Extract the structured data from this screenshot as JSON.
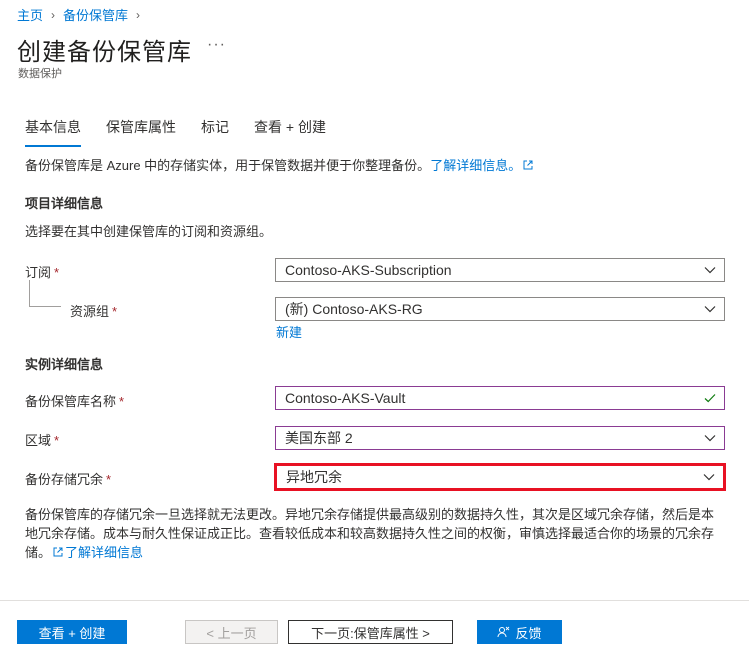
{
  "breadcrumb": {
    "home": "主页",
    "vault": "备份保管库"
  },
  "header": {
    "title": "创建备份保管库",
    "more": "···",
    "subtitle": "数据保护"
  },
  "tabs": [
    {
      "label": "基本信息",
      "active": true
    },
    {
      "label": "保管库属性",
      "active": false
    },
    {
      "label": "标记",
      "active": false
    },
    {
      "label": "查看 + 创建",
      "active": false
    }
  ],
  "intro": {
    "text": "备份保管库是 Azure 中的存储实体，用于保管数据并便于你整理备份。",
    "link": "了解详细信息。"
  },
  "project": {
    "heading": "项目详细信息",
    "desc": "选择要在其中创建保管库的订阅和资源组。",
    "subscription_label": "订阅",
    "subscription_value": "Contoso-AKS-Subscription",
    "rg_label": "资源组",
    "rg_value": "(新) Contoso-AKS-RG",
    "new_link": "新建"
  },
  "instance": {
    "heading": "实例详细信息",
    "name_label": "备份保管库名称",
    "name_value": "Contoso-AKS-Vault",
    "region_label": "区域",
    "region_value": "美国东部 2",
    "redundancy_label": "备份存储冗余",
    "redundancy_value": "异地冗余"
  },
  "required_mark": "*",
  "note": {
    "text": "备份保管库的存储冗余一旦选择就无法更改。异地冗余存储提供最高级别的数据持久性，其次是区域冗余存储，然后是本地冗余存储。成本与耐久性保证成正比。查看较低成本和较高数据持久性之间的权衡，审慎选择最适合你的场景的冗余存储。",
    "link": "了解详细信息"
  },
  "footer": {
    "review_create": "查看 + 创建",
    "prev": "< 上一页",
    "next": "下一页:保管库属性  >",
    "feedback": "反馈"
  },
  "colors": {
    "accent": "#0078d4",
    "highlight": "#e81123",
    "valid": "#107c10",
    "required": "#a4262c"
  }
}
